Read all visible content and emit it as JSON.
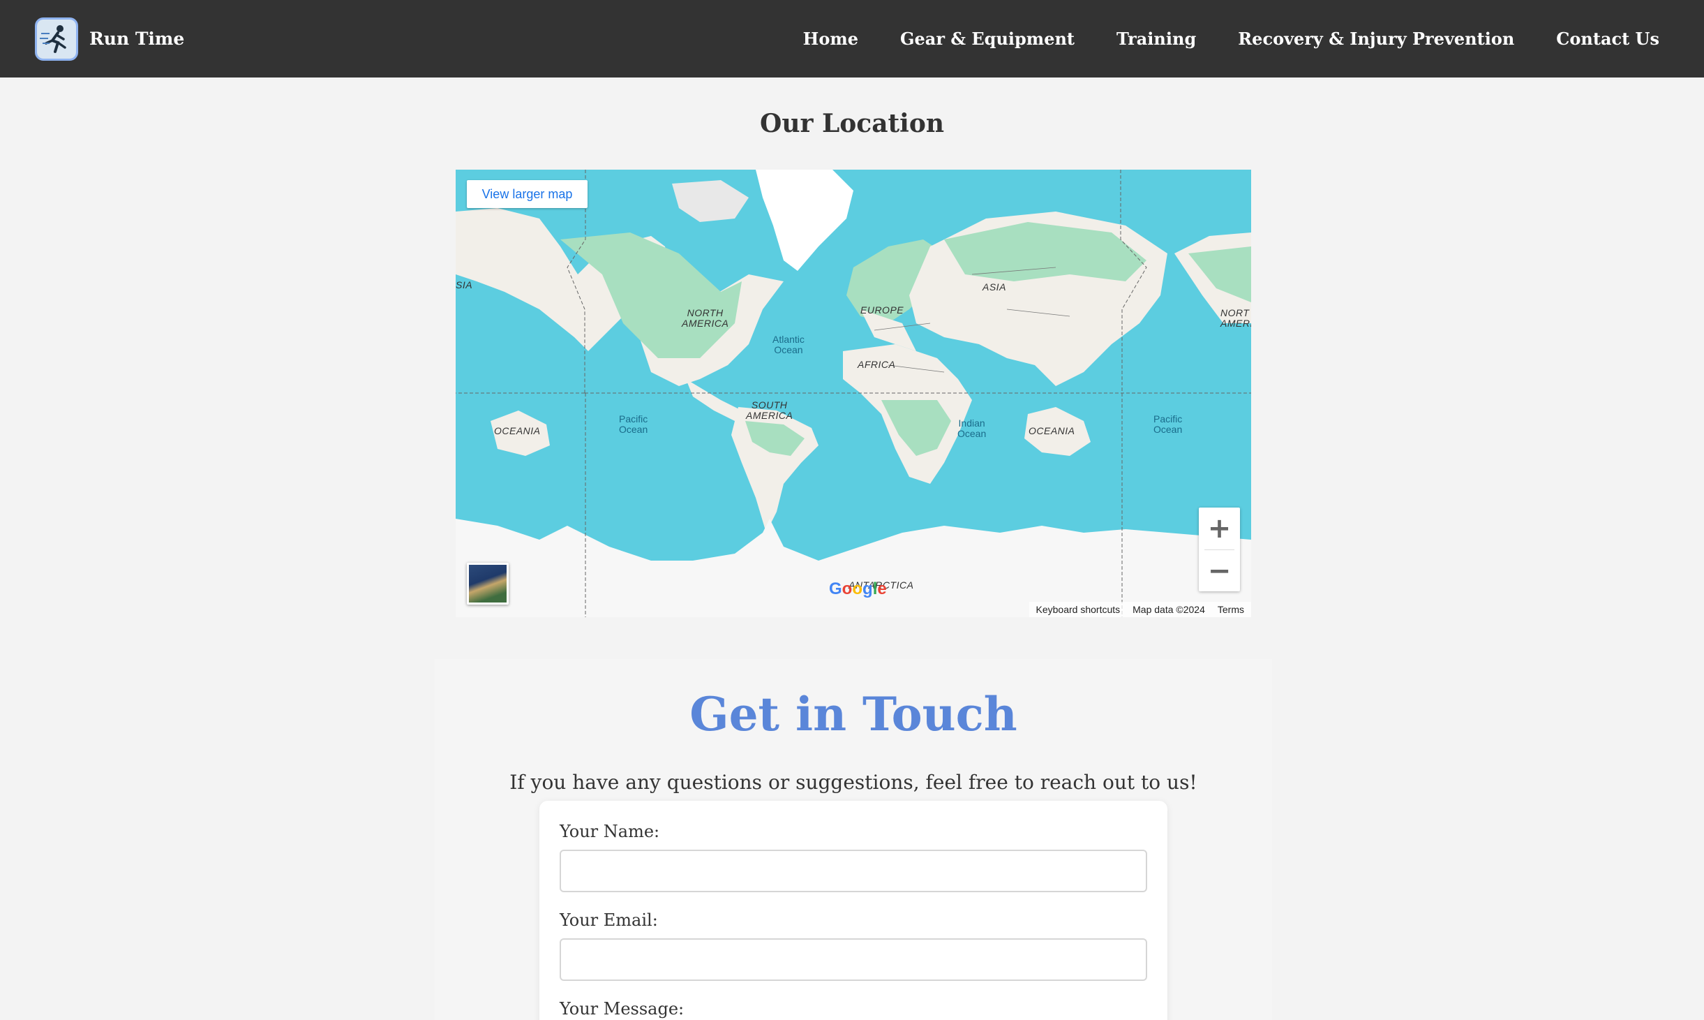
{
  "header": {
    "brand_name": "Run Time",
    "nav": [
      "Home",
      "Gear & Equipment",
      "Training",
      "Recovery & Injury Prevention",
      "Contact Us"
    ]
  },
  "location": {
    "title": "Our Location",
    "map": {
      "view_larger": "View larger map",
      "labels": {
        "asia_left": "SIA",
        "north_america": "NORTH\nAMERICA",
        "atlantic": "Atlantic\nOcean",
        "europe": "EUROPE",
        "asia": "ASIA",
        "africa": "AFRICA",
        "north_america_right": "NORT\nAMERI",
        "south_america": "SOUTH\nAMERICA",
        "pacific_left": "Pacific\nOcean",
        "indian": "Indian\nOcean",
        "pacific_right": "Pacific\nOcean",
        "oceania_left": "OCEANIA",
        "oceania_right": "OCEANIA",
        "antarctica": "ANTARCTICA"
      },
      "zoom_in": "+",
      "zoom_out": "−",
      "google": "Google",
      "footer": {
        "shortcuts": "Keyboard shortcuts",
        "map_data": "Map data ©2024",
        "terms": "Terms"
      },
      "colors": {
        "water": "#5ccde0",
        "land": "#f2efe9",
        "forest": "#a8dfc0"
      }
    }
  },
  "contact": {
    "title": "Get in Touch",
    "intro": "If you have any questions or suggestions, feel free to reach out to us!",
    "name_label": "Your Name:",
    "email_label": "Your Email:",
    "message_label": "Your Message:"
  },
  "colors": {
    "nav_bg": "#333333",
    "accent": "#5a86d9"
  }
}
